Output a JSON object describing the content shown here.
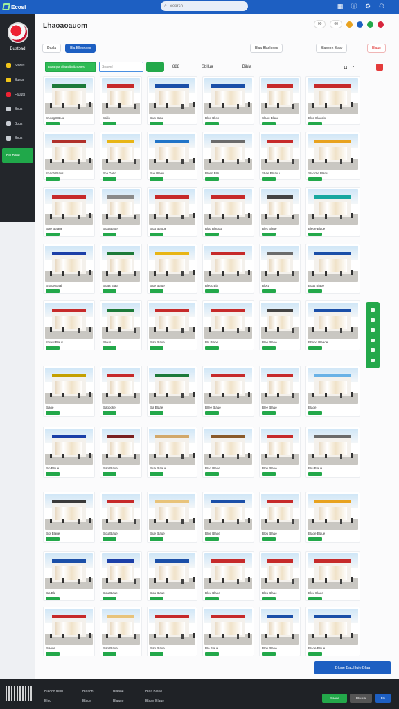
{
  "topbar": {
    "logo": "Ecosi",
    "search_placeholder": "Search"
  },
  "sidebar": {
    "user": "Bustbad",
    "items": [
      {
        "label": "Stores"
      },
      {
        "label": "Buous"
      },
      {
        "label": "Fauuts"
      },
      {
        "label": "Bous"
      },
      {
        "label": "Bous"
      },
      {
        "label": "Bous"
      }
    ],
    "active_label": "Blu Blioe"
  },
  "main": {
    "title": "Lhaoaoauom",
    "header_pills": [
      "00",
      "00"
    ],
    "header_dot_colors": [
      "#e8a21f",
      "#1d5fc2",
      "#23a84a",
      "#d7263d"
    ],
    "buttons": {
      "filter": "Daala",
      "primary": "Bla Bllecnaos",
      "sort": "Blaa Blaoleoss",
      "filter2": "Blaooon Blaar",
      "red": "Blaao"
    },
    "green_select": "Blaanpa olbaa lbaibnooes",
    "input_placeholder": "Snaoel",
    "tabs": [
      "888",
      "Sbllua",
      "Bibla"
    ],
    "footer_cta": "Bluue Bacil luie Blaa"
  },
  "cards": [
    {
      "title": "Shoog BBluo",
      "color": "#1d7a3a"
    },
    {
      "title": "Sallis",
      "color": "#c62a2a"
    },
    {
      "title": "Blus Blaut",
      "color": "#1b4fa8"
    },
    {
      "title": "Bluo Bllon",
      "color": "#1b4fa8"
    },
    {
      "title": "Slaou Blanu",
      "color": "#c62a2a"
    },
    {
      "title": "Blue Blavolo",
      "color": "#c62a2a"
    },
    {
      "title": "Shaoh Blaus",
      "color": "#b0302a"
    },
    {
      "title": "Boa Dallo",
      "color": "#e8b515"
    },
    {
      "title": "Bue Blaeu",
      "color": "#2074c8"
    },
    {
      "title": "Bluen Bllo",
      "color": "#6b6b6b"
    },
    {
      "title": "Shae Blaauu",
      "color": "#c62a2a"
    },
    {
      "title": "Slaoclie Blanu",
      "color": "#e8a21f"
    },
    {
      "title": "Blae Blaaue",
      "color": "#c62a2a"
    },
    {
      "title": "Blou Blaoe",
      "color": "#8a8a8a"
    },
    {
      "title": "Blou Blaoue",
      "color": "#c62a2a"
    },
    {
      "title": "Blac Blaouu",
      "color": "#c62a2a"
    },
    {
      "title": "Bles Blaue",
      "color": "#444"
    },
    {
      "title": "Bleoe Blaue",
      "color": "#18a8a0"
    },
    {
      "title": "Bhaoe Baal",
      "color": "#1b3fa8"
    },
    {
      "title": "Bloaa Blala",
      "color": "#1d7a3a"
    },
    {
      "title": "Blue Blaue",
      "color": "#e8b515"
    },
    {
      "title": "Bleoc Bla",
      "color": "#c62a2a"
    },
    {
      "title": "Bloca",
      "color": "#6b6b6b"
    },
    {
      "title": "Bous Blaue",
      "color": "#1b4fa8"
    },
    {
      "title": "Shlaal Blaus",
      "color": "#c62a2a"
    },
    {
      "title": "Bllous",
      "color": "#1d7a3a"
    },
    {
      "title": "Blao Blaue",
      "color": "#c62a2a"
    },
    {
      "title": "Bls Blaoe",
      "color": "#c62a2a"
    },
    {
      "title": "Bleo Blaue",
      "color": "#444"
    },
    {
      "title": "Bheoo Blaaoe",
      "color": "#1b4fa8"
    },
    {
      "title": "Blaoe",
      "color": "#c4a000"
    },
    {
      "title": "Blaoooke",
      "color": "#c62a2a"
    },
    {
      "title": "Bla Blaae",
      "color": "#1d7a3a"
    },
    {
      "title": "Bllee Blaue",
      "color": "#c62a2a"
    },
    {
      "title": "Blee Blaue",
      "color": "#c62a2a"
    },
    {
      "title": "Blaoe",
      "color": "#6ab2e6"
    },
    {
      "title": "Blo Blaue",
      "color": "#1b3fa8"
    },
    {
      "title": "Blao Blaue",
      "color": "#7a2020"
    },
    {
      "title": "Blua Blaaue",
      "color": "#d2a86a"
    },
    {
      "title": "Blao Blaue",
      "color": "#8a5a2a"
    },
    {
      "title": "Blou Blaue",
      "color": "#c62a2a"
    },
    {
      "title": "Bliu Blaue",
      "color": "#6b6b6b"
    },
    {
      "title": "Blol Blaue",
      "color": "#3a3a3a"
    },
    {
      "title": "Blou Blaue",
      "color": "#c62a2a"
    },
    {
      "title": "Blue Blaue",
      "color": "#e8c37a"
    },
    {
      "title": "Blue Blaue",
      "color": "#1b4fa8"
    },
    {
      "title": "Blou Blaue",
      "color": "#c62a2a"
    },
    {
      "title": "Blaoe Blaue",
      "color": "#e8a21f"
    },
    {
      "title": "Bla Bla",
      "color": "#1b4fa8"
    },
    {
      "title": "Blou Blaue",
      "color": "#1b3fa8"
    },
    {
      "title": "Blou Blaue",
      "color": "#1b4fa8"
    },
    {
      "title": "Blou Blaue",
      "color": "#c62a2a"
    },
    {
      "title": "Blou Blaue",
      "color": "#c62a2a"
    },
    {
      "title": "Blou Blaue",
      "color": "#c62a2a"
    },
    {
      "title": "Blaoue",
      "color": "#c62a2a"
    },
    {
      "title": "Blao Blaue",
      "color": "#e8c37a"
    },
    {
      "title": "Blao Blaue",
      "color": "#c62a2a"
    },
    {
      "title": "Blo Blaue",
      "color": "#c62a2a"
    },
    {
      "title": "Blou Blaue",
      "color": "#1b4fa8"
    },
    {
      "title": "Blaoe Blaue",
      "color": "#1b4fa8"
    }
  ],
  "footer": {
    "col1": [
      "Blaooo Bluu",
      "Blou"
    ],
    "col2": [
      "Blaaon",
      "Blaue"
    ],
    "col3": [
      "Blaaoe",
      "Blaaoe"
    ],
    "col4": [
      "Blaa Blaue",
      "Blaao Blaue"
    ],
    "buttons": [
      "Blaeue",
      "Blauue",
      "Blu"
    ]
  }
}
